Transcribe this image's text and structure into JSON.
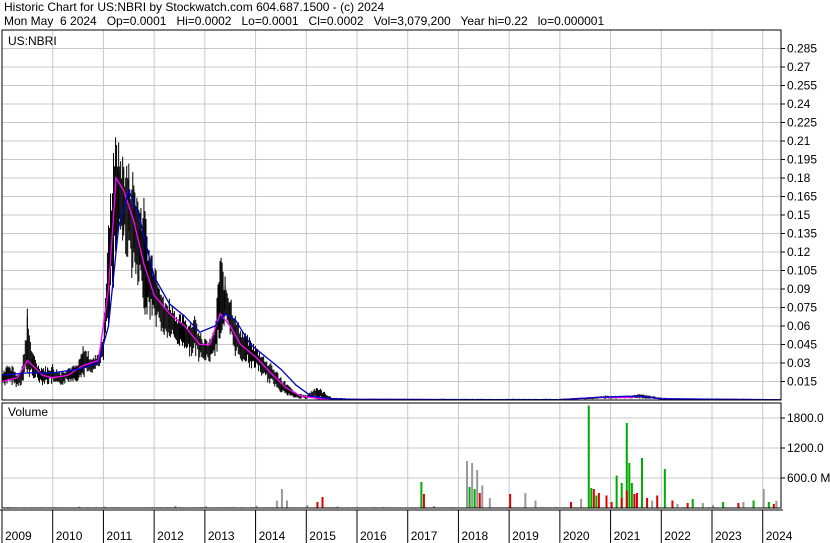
{
  "header": {
    "line1": "Historic Chart for US:NBRI by Stockwatch.com 604.687.1500 - (c) 2024",
    "line2": "Mon May  6 2024   Op=0.0001   Hi=0.0002   Lo=0.0001   Cl=0.0002   Vol=3,079,200   Year hi=0.22   lo=0.000001"
  },
  "colors": {
    "price_bars": "#000000",
    "ma_short": "#ff00ff",
    "ma_long": "#0000cc",
    "volume_up": "#00aa00",
    "volume_down": "#dd0000",
    "volume_neutral": "#999999",
    "grid": "#c8c8c8"
  },
  "chart_data": [
    {
      "type": "line",
      "panel": "price",
      "title": "US:NBRI",
      "ylim": [
        0,
        0.3
      ],
      "y_ticks": [
        "0.285",
        "0.27",
        "0.255",
        "0.24",
        "0.225",
        "0.21",
        "0.195",
        "0.18",
        "0.165",
        "0.15",
        "0.135",
        "0.12",
        "0.105",
        "0.09",
        "0.075",
        "0.06",
        "0.045",
        "0.03",
        "0.015"
      ],
      "x_ticks": [
        "2009",
        "2010",
        "2011",
        "2012",
        "2013",
        "2014",
        "2015",
        "2016",
        "2017",
        "2018",
        "2019",
        "2020",
        "2021",
        "2022",
        "2023",
        "2024"
      ],
      "grid": true,
      "series": [
        {
          "style": "high-low bars",
          "x": [
            2009.0,
            2009.1,
            2009.2,
            2009.3,
            2009.4,
            2009.5,
            2009.6,
            2009.7,
            2009.8,
            2009.9,
            2010.0,
            2010.1,
            2010.2,
            2010.3,
            2010.4,
            2010.5,
            2010.6,
            2010.7,
            2010.8,
            2010.9,
            2011.0,
            2011.1,
            2011.2,
            2011.3,
            2011.4,
            2011.5,
            2011.6,
            2011.7,
            2011.8,
            2011.9,
            2012.0,
            2012.1,
            2012.2,
            2012.3,
            2012.4,
            2012.5,
            2012.6,
            2012.7,
            2012.8,
            2012.9,
            2013.0,
            2013.1,
            2013.2,
            2013.3,
            2013.4,
            2013.5,
            2013.6,
            2013.7,
            2013.8,
            2013.9,
            2014.0,
            2014.1,
            2014.2,
            2014.3,
            2014.4,
            2014.5,
            2014.6,
            2014.7,
            2014.8,
            2014.9,
            2015.0,
            2015.2,
            2015.5,
            2016.0,
            2017.0,
            2018.0,
            2019.0,
            2020.0,
            2020.6,
            2020.9,
            2021.3,
            2021.6,
            2022.0,
            2022.5,
            2023.0,
            2023.5,
            2024.0,
            2024.35
          ],
          "high": [
            0.025,
            0.03,
            0.028,
            0.022,
            0.03,
            0.075,
            0.04,
            0.03,
            0.028,
            0.028,
            0.03,
            0.025,
            0.025,
            0.028,
            0.028,
            0.03,
            0.045,
            0.04,
            0.035,
            0.04,
            0.055,
            0.145,
            0.22,
            0.21,
            0.2,
            0.195,
            0.19,
            0.17,
            0.165,
            0.13,
            0.12,
            0.105,
            0.08,
            0.085,
            0.075,
            0.07,
            0.07,
            0.065,
            0.07,
            0.06,
            0.05,
            0.05,
            0.06,
            0.125,
            0.1,
            0.09,
            0.07,
            0.06,
            0.055,
            0.05,
            0.045,
            0.04,
            0.035,
            0.03,
            0.025,
            0.02,
            0.015,
            0.01,
            0.006,
            0.005,
            0.004,
            0.012,
            0.002,
            0.001,
            0.001,
            0.001,
            0.001,
            0.001,
            0.002,
            0.004,
            0.003,
            0.005,
            0.002,
            0.001,
            0.001,
            0.001,
            0.001,
            0.0002
          ],
          "low": [
            0.01,
            0.012,
            0.012,
            0.01,
            0.012,
            0.015,
            0.018,
            0.015,
            0.012,
            0.012,
            0.012,
            0.01,
            0.012,
            0.014,
            0.015,
            0.015,
            0.018,
            0.02,
            0.022,
            0.025,
            0.03,
            0.06,
            0.09,
            0.13,
            0.12,
            0.11,
            0.09,
            0.08,
            0.07,
            0.065,
            0.06,
            0.055,
            0.05,
            0.048,
            0.045,
            0.042,
            0.04,
            0.035,
            0.035,
            0.03,
            0.03,
            0.03,
            0.035,
            0.045,
            0.06,
            0.045,
            0.035,
            0.03,
            0.03,
            0.025,
            0.025,
            0.02,
            0.015,
            0.012,
            0.01,
            0.006,
            0.003,
            0.002,
            0.001,
            0.001,
            0.0005,
            0.0005,
            0.0003,
            0.0002,
            0.0002,
            0.0002,
            0.0002,
            0.0002,
            0.0005,
            0.001,
            0.001,
            0.001,
            0.0005,
            0.0002,
            0.0001,
            0.0001,
            0.0001,
            0.0001
          ]
        },
        {
          "style": "line",
          "color": "#ff00ff",
          "x": [
            2009.0,
            2009.3,
            2009.5,
            2009.8,
            2010.0,
            2010.3,
            2010.6,
            2010.9,
            2011.1,
            2011.25,
            2011.4,
            2011.6,
            2011.8,
            2012.0,
            2012.3,
            2012.6,
            2012.9,
            2013.1,
            2013.3,
            2013.5,
            2013.7,
            2014.0,
            2014.3,
            2014.6,
            2014.9,
            2015.3,
            2016.0,
            2018.0,
            2020.0,
            2020.7,
            2021.3,
            2021.6,
            2022.0,
            2024.35
          ],
          "y": [
            0.015,
            0.018,
            0.032,
            0.02,
            0.018,
            0.02,
            0.028,
            0.032,
            0.09,
            0.18,
            0.17,
            0.145,
            0.11,
            0.085,
            0.07,
            0.06,
            0.045,
            0.045,
            0.07,
            0.06,
            0.045,
            0.035,
            0.022,
            0.01,
            0.003,
            0.001,
            0.0005,
            0.0003,
            0.0003,
            0.002,
            0.002,
            0.003,
            0.001,
            0.0002
          ]
        },
        {
          "style": "line",
          "color": "#0000cc",
          "x": [
            2009.0,
            2009.5,
            2010.0,
            2010.5,
            2010.9,
            2011.1,
            2011.3,
            2011.5,
            2011.7,
            2012.0,
            2012.3,
            2012.6,
            2012.9,
            2013.2,
            2013.4,
            2013.6,
            2013.9,
            2014.2,
            2014.5,
            2014.8,
            2015.1,
            2015.5,
            2016.0,
            2018.0,
            2020.0,
            2020.7,
            2021.3,
            2021.6,
            2022.0,
            2024.35
          ],
          "y": [
            0.02,
            0.022,
            0.022,
            0.025,
            0.03,
            0.06,
            0.14,
            0.17,
            0.15,
            0.1,
            0.078,
            0.068,
            0.055,
            0.06,
            0.07,
            0.065,
            0.045,
            0.035,
            0.025,
            0.012,
            0.003,
            0.001,
            0.0005,
            0.0003,
            0.0003,
            0.002,
            0.003,
            0.003,
            0.001,
            0.0002
          ]
        }
      ]
    },
    {
      "type": "bar",
      "panel": "volume",
      "title": "Volume",
      "ylim": [
        0,
        2100
      ],
      "y_ticks": [
        "1800.0",
        "1200.0",
        "600.0 M"
      ],
      "x_ticks": [
        "2009",
        "2010",
        "2011",
        "2012",
        "2013",
        "2014",
        "2015",
        "2016",
        "2017",
        "2018",
        "2019",
        "2020",
        "2021",
        "2022",
        "2023",
        "2024"
      ],
      "series": [
        {
          "name": "up",
          "x": [
            2017.25,
            2018.2,
            2018.3,
            2020.55,
            2020.6,
            2020.7,
            2021.1,
            2021.2,
            2021.3,
            2021.35,
            2021.4,
            2021.6,
            2022.05,
            2022.6,
            2023.2,
            2023.8,
            2024.1
          ],
          "values": [
            520,
            420,
            380,
            2050,
            400,
            250,
            650,
            500,
            1700,
            900,
            500,
            1000,
            780,
            180,
            120,
            150,
            120
          ]
        },
        {
          "name": "down",
          "x": [
            2015.2,
            2015.3,
            2017.3,
            2018.4,
            2019.0,
            2020.2,
            2020.65,
            2020.75,
            2020.9,
            2021.0,
            2021.2,
            2021.3,
            2021.45,
            2021.5,
            2021.7,
            2021.9,
            2022.2,
            2022.5,
            2023.5,
            2024.2
          ],
          "values": [
            120,
            220,
            280,
            300,
            280,
            120,
            380,
            300,
            250,
            120,
            200,
            350,
            280,
            300,
            200,
            250,
            150,
            100,
            100,
            80
          ]
        },
        {
          "name": "neutral",
          "x": [
            2009.1,
            2010.5,
            2011.0,
            2012.4,
            2013.0,
            2014.0,
            2014.4,
            2014.5,
            2014.6,
            2015.0,
            2015.6,
            2016.5,
            2017.5,
            2018.15,
            2018.25,
            2018.35,
            2018.45,
            2018.6,
            2019.3,
            2019.5,
            2020.4,
            2021.8,
            2022.3,
            2022.8,
            2023.0,
            2023.6,
            2024.0,
            2024.25
          ],
          "values": [
            20,
            25,
            30,
            40,
            35,
            45,
            150,
            380,
            150,
            60,
            30,
            20,
            40,
            940,
            900,
            760,
            450,
            200,
            300,
            150,
            180,
            150,
            80,
            100,
            60,
            120,
            380,
            140
          ]
        }
      ]
    }
  ]
}
